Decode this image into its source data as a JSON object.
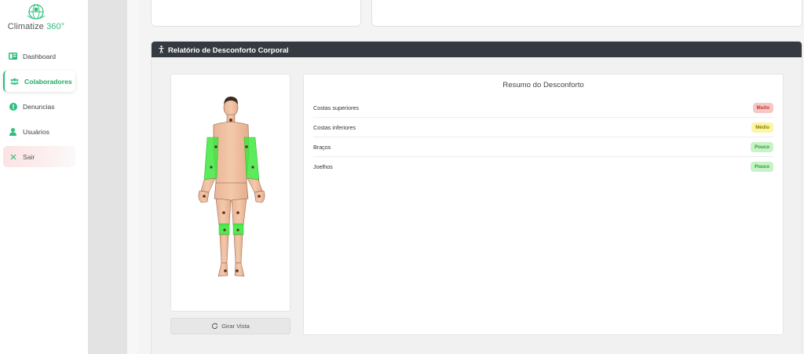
{
  "sidebar": {
    "logo_text": "Climatize",
    "logo_accent": "360°",
    "items": [
      {
        "label": "Dashboard",
        "icon": "dashboard-icon"
      },
      {
        "label": "Colaboradores",
        "icon": "users-icon",
        "active": true
      },
      {
        "label": "Denuncias",
        "icon": "alert-icon"
      },
      {
        "label": "Usuários",
        "icon": "user-icon"
      },
      {
        "label": "Sair",
        "icon": "close-icon"
      }
    ]
  },
  "panel": {
    "title": "Relatório de Desconforto Corporal",
    "rotate_label": "Girar Vista",
    "summary_title": "Resumo do Desconforto",
    "rows": [
      {
        "part": "Costas superiores",
        "level": "Muito"
      },
      {
        "part": "Costas inferiores",
        "level": "Médio"
      },
      {
        "part": "Braços",
        "level": "Pouco"
      },
      {
        "part": "Joelhos",
        "level": "Pouco"
      }
    ]
  },
  "colors": {
    "brand": "#2bbf7a",
    "header": "#343a40",
    "highlight": "#3ee83e",
    "muito": "#f7c7c7",
    "medio": "#fbf6a6",
    "pouco": "#c8f3c8"
  }
}
